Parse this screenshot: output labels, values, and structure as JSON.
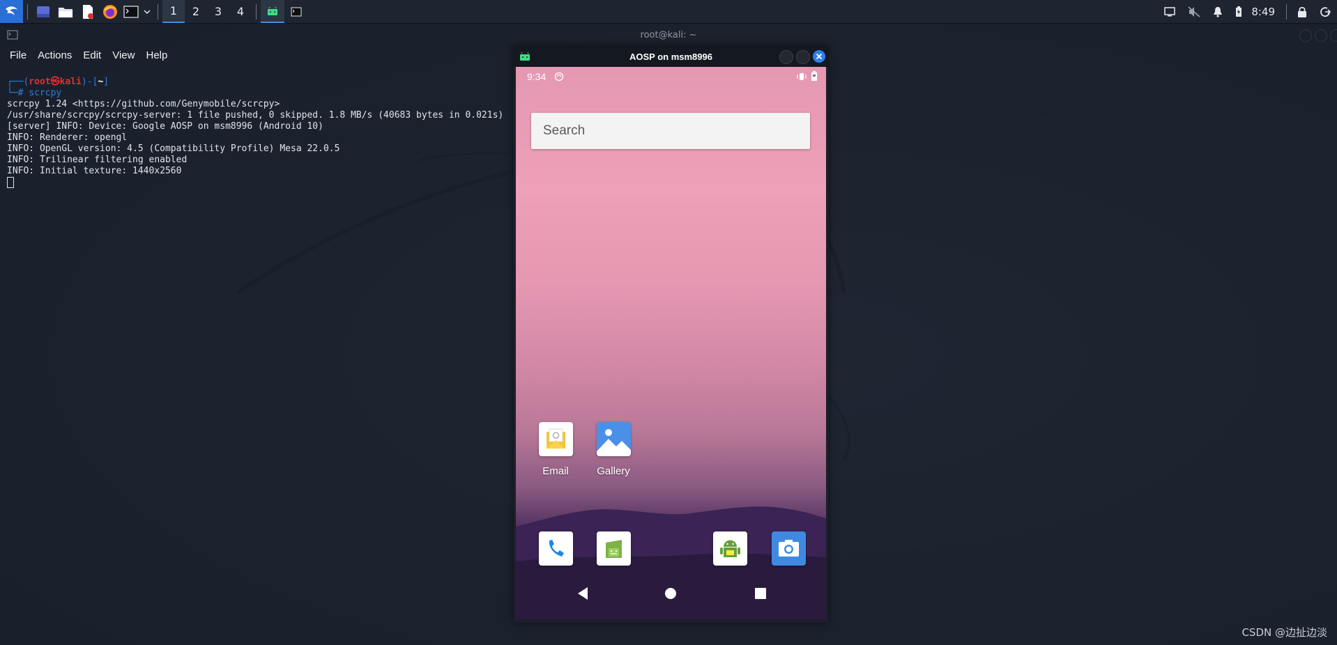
{
  "taskbar": {
    "launcher_icons": [
      "kali-menu-icon",
      "desktop-icon",
      "file-manager-icon",
      "text-editor-icon",
      "firefox-icon",
      "terminal-icon"
    ],
    "workspaces": [
      "1",
      "2",
      "3",
      "4"
    ],
    "active_workspace": "1",
    "time": "8:49",
    "accent": "#3d8fe0"
  },
  "terminal": {
    "title": "root@kali: ~",
    "menu": [
      "File",
      "Actions",
      "Edit",
      "View",
      "Help"
    ],
    "prompt": {
      "open": "┌──(",
      "user": "root㉿kali",
      "close": ")-[",
      "dir": "~",
      "end": "]",
      "hash": "└─#",
      "command": "scrcpy"
    },
    "output": [
      "scrcpy 1.24 <https://github.com/Genymobile/scrcpy>",
      "/usr/share/scrcpy/scrcpy-server: 1 file pushed, 0 skipped. 1.8 MB/s (40683 bytes in 0.021s)",
      "[server] INFO: Device: Google AOSP on msm8996 (Android 10)",
      "INFO: Renderer: opengl",
      "INFO: OpenGL version: 4.5 (Compatibility Profile) Mesa 22.0.5",
      "INFO: Trilinear filtering enabled",
      "INFO: Initial texture: 1440x2560"
    ]
  },
  "scrcpy": {
    "title": "AOSP on msm8996",
    "phone": {
      "clock": "9:34",
      "search_placeholder": "Search",
      "apps": [
        {
          "label": "Email",
          "icon": "email-app-icon"
        },
        {
          "label": "Gallery",
          "icon": "gallery-app-icon"
        }
      ],
      "dock": [
        "phone-app-icon",
        "messages-app-icon",
        "android-app-icon",
        "camera-app-icon"
      ],
      "nav": [
        "back-icon",
        "home-icon",
        "recents-icon"
      ]
    }
  },
  "watermark": "CSDN @边扯边淡"
}
